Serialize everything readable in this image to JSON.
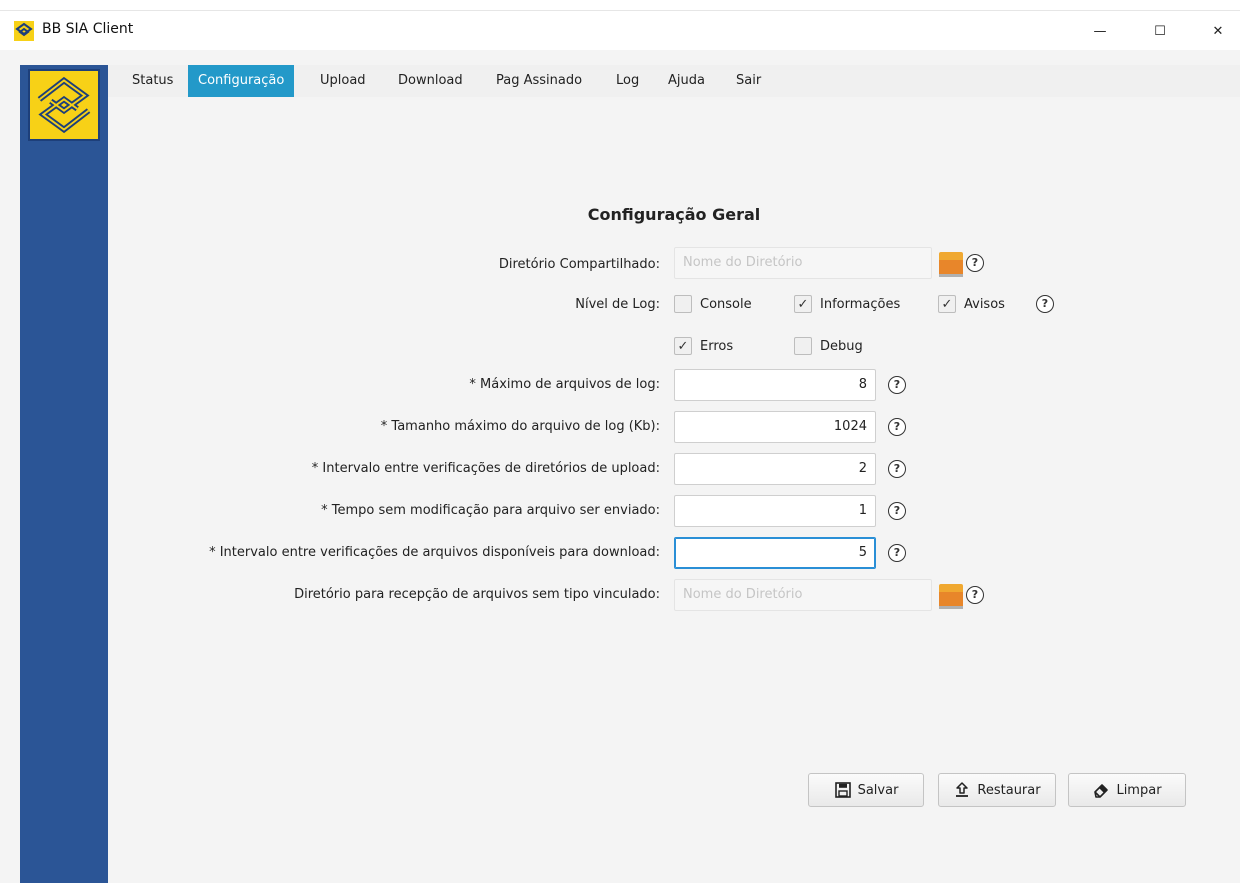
{
  "window": {
    "title": "BB SIA Client",
    "minimize_glyph": "—",
    "maximize_glyph": "☐",
    "close_glyph": "✕"
  },
  "menu": [
    "Status",
    "Configuração",
    "Upload",
    "Download",
    "Pag Assinado",
    "Log",
    "Ajuda",
    "Sair"
  ],
  "active_menu": "Configuração",
  "section_title": "Configuração Geral",
  "fields": {
    "shared_dir": {
      "label": "Diretório Compartilhado:",
      "placeholder": "Nome do Diretório"
    },
    "log_level": {
      "label": "Nível de Log:",
      "options": [
        {
          "label": "Console",
          "checked": false
        },
        {
          "label": "Informações",
          "checked": true
        },
        {
          "label": "Avisos",
          "checked": true
        },
        {
          "label": "Erros",
          "checked": true
        },
        {
          "label": "Debug",
          "checked": false
        }
      ]
    },
    "max_log_files": {
      "label": "* Máximo de arquivos de log:",
      "value": "8"
    },
    "max_log_size": {
      "label": "* Tamanho máximo do arquivo de log (Kb):",
      "value": "1024"
    },
    "upload_check_interval": {
      "label": "* Intervalo entre verificações de diretórios de upload:",
      "value": "2"
    },
    "idle_time": {
      "label": "* Tempo sem modificação para arquivo ser enviado:",
      "value": "1"
    },
    "download_check_interval": {
      "label": "* Intervalo entre verificações de arquivos disponíveis para download:",
      "value": "5"
    },
    "untyped_dir": {
      "label": "Diretório para recepção de arquivos sem tipo vinculado:",
      "placeholder": "Nome do Diretório"
    }
  },
  "help_glyph": "?",
  "check_glyph": "✓",
  "buttons": {
    "save": "Salvar",
    "restore": "Restaurar",
    "clear": "Limpar"
  },
  "colors": {
    "rail": "#2b5596",
    "logo": "#f7d117",
    "active_tab": "#2399c9",
    "focus": "#2a8fd6"
  }
}
